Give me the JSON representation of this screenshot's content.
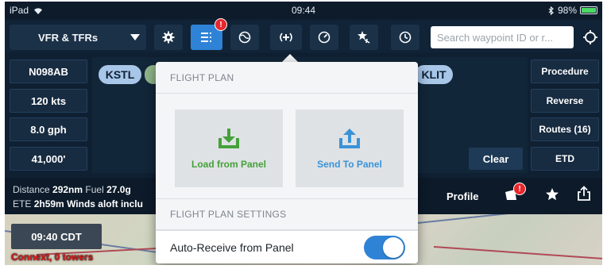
{
  "status_bar": {
    "device": "iPad",
    "time": "09:44",
    "battery": "98%",
    "battery_level": 0.98
  },
  "toolbar": {
    "layer_select": "VFR & TFRs",
    "flight_plan_badge": "!",
    "search_placeholder": "Search waypoint ID or r..."
  },
  "left_panel": {
    "aircraft": "N098AB",
    "speed": "120 kts",
    "fuel_flow": "8.0 gph",
    "altitude": "41,000'"
  },
  "route": {
    "origin": "KSTL",
    "destination": "KLIT",
    "clear_label": "Clear"
  },
  "right_panel": {
    "procedure": "Procedure",
    "reverse": "Reverse",
    "routes": "Routes (16)",
    "etd": "ETD"
  },
  "info_strip": {
    "distance_label": "Distance",
    "distance": "292nm",
    "fuel_label": "Fuel",
    "fuel": "27.0g",
    "ete_label": "ETE",
    "ete": "2h59m",
    "winds_label": "Winds aloft inclu",
    "profile_label": "Profile",
    "alerts_badge": "!"
  },
  "map": {
    "time": "09:40 CDT",
    "connect_text": "Connext, 0 towers"
  },
  "popover": {
    "flight_plan_header": "FLIGHT PLAN",
    "load_label": "Load from Panel",
    "send_label": "Send To Panel",
    "settings_header": "FLIGHT PLAN SETTINGS",
    "auto_receive_label": "Auto-Receive from Panel",
    "auto_receive_on": true
  },
  "colors": {
    "accent_blue": "#2f83d6",
    "load_green": "#45a13a",
    "send_blue": "#3a93d8",
    "alert_red": "#e8262c"
  }
}
